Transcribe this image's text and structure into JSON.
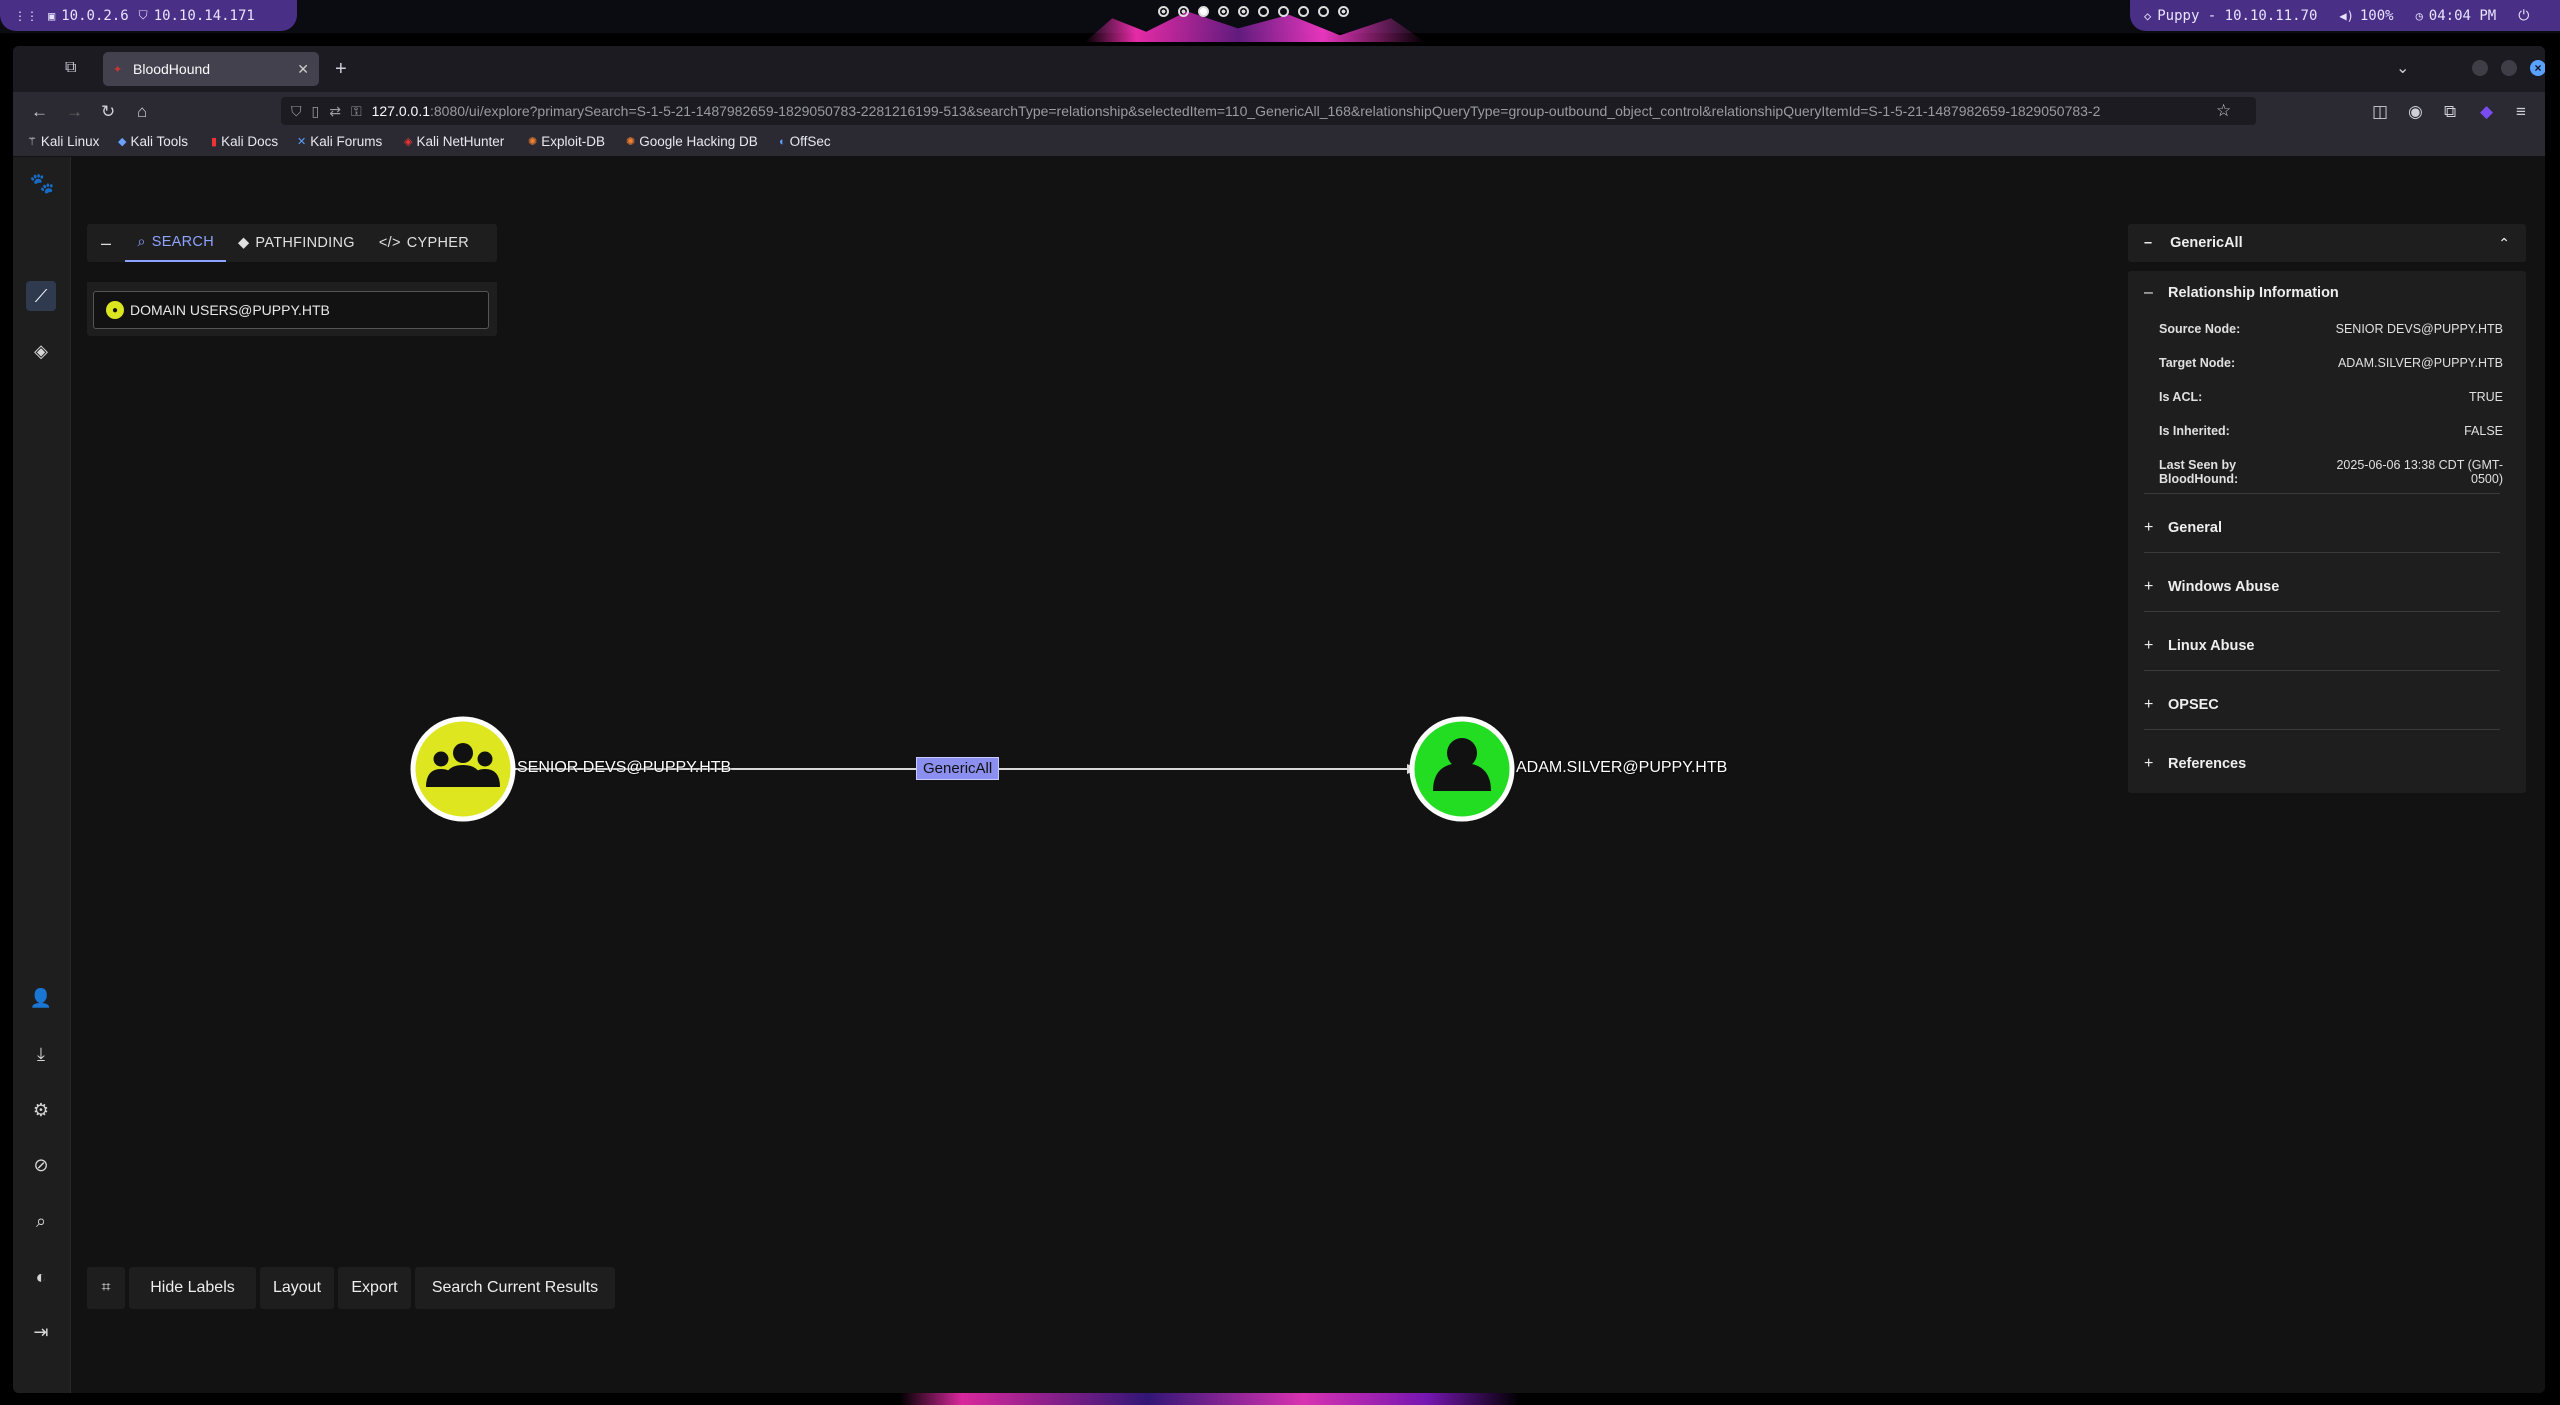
{
  "system_bar": {
    "left_pill": [
      {
        "icon": "grid-icon",
        "text": ""
      },
      {
        "icon": "monitor-icon",
        "text": "10.0.2.6"
      },
      {
        "icon": "shield-icon",
        "text": "10.10.14.171"
      }
    ],
    "right_pill": {
      "target": "Puppy - 10.10.11.70",
      "volume": "100%",
      "time": "04:04 PM"
    }
  },
  "browser": {
    "tab_title": "BloodHound",
    "url_host": "127.0.0.1",
    "url_rest": ":8080/ui/explore?primarySearch=S-1-5-21-1487982659-1829050783-2281216199-513&searchType=relationship&selectedItem=110_GenericAll_168&relationshipQueryType=group-outbound_object_control&relationshipQueryItemId=S-1-5-21-1487982659-1829050783-2",
    "bookmarks": [
      "Kali Linux",
      "Kali Tools",
      "Kali Docs",
      "Kali Forums",
      "Kali NetHunter",
      "Exploit-DB",
      "Google Hacking DB",
      "OffSec"
    ]
  },
  "explore": {
    "tabs": {
      "collapse": "–",
      "search": "SEARCH",
      "pathfinding": "PATHFINDING",
      "cypher": "CYPHER"
    },
    "search_value": "DOMAIN USERS@PUPPY.HTB"
  },
  "graph": {
    "source_node": {
      "label": "SENIOR DEVS@PUPPY.HTB",
      "type": "group",
      "color": "#dde61f"
    },
    "target_node": {
      "label": "ADAM.SILVER@PUPPY.HTB",
      "type": "user",
      "color": "#22dd22"
    },
    "edge_label": "GenericAll"
  },
  "panel": {
    "title": "GenericAll",
    "relationship_info": {
      "heading": "Relationship Information",
      "rows": [
        {
          "key": "Source Node:",
          "value": "SENIOR DEVS@PUPPY.HTB"
        },
        {
          "key": "Target Node:",
          "value": "ADAM.SILVER@PUPPY.HTB"
        },
        {
          "key": "Is ACL:",
          "value": "TRUE"
        },
        {
          "key": "Is Inherited:",
          "value": "FALSE"
        },
        {
          "key": "Last Seen by BloodHound:",
          "value": "2025-06-06 13:38 CDT (GMT-0500)"
        }
      ]
    },
    "sections": [
      "General",
      "Windows Abuse",
      "Linux Abuse",
      "OPSEC",
      "References"
    ]
  },
  "toolbar": {
    "hide_labels": "Hide Labels",
    "layout": "Layout",
    "export": "Export",
    "search_results": "Search Current Results"
  }
}
